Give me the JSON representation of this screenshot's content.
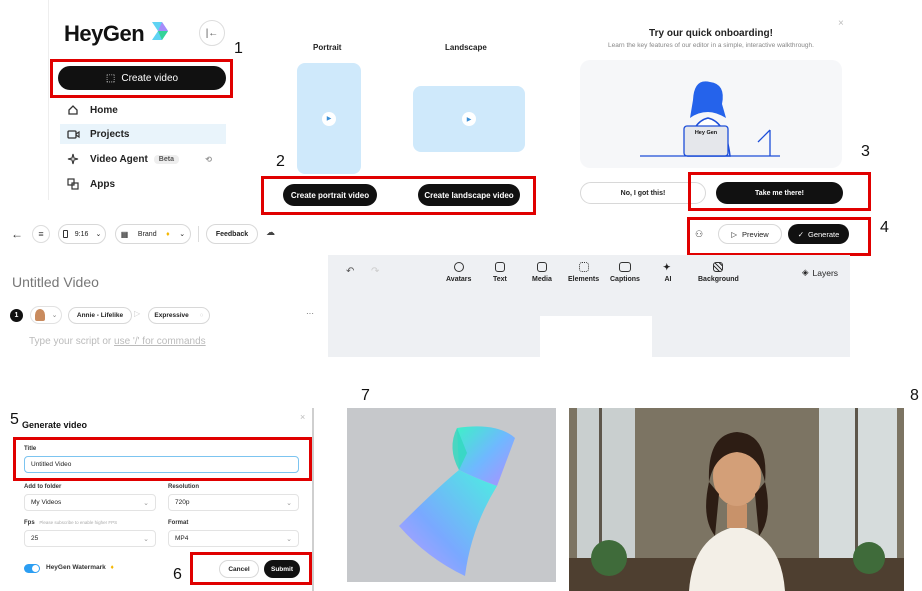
{
  "steps": {
    "s1": "1",
    "s2": "2",
    "s3": "3",
    "s4": "4",
    "s5": "5",
    "s6": "6",
    "s7": "7",
    "s8": "8"
  },
  "brand": {
    "logo_text": "HeyGen"
  },
  "sidebar": {
    "create_video_label": "Create video",
    "items": [
      {
        "label": "Home",
        "icon": "home-icon"
      },
      {
        "label": "Projects",
        "icon": "video-camera-icon"
      },
      {
        "label": "Video Agent",
        "icon": "sparkle-icon",
        "badge": "Beta"
      },
      {
        "label": "Apps",
        "icon": "apps-icon"
      }
    ]
  },
  "orientation": {
    "portrait_label": "Portrait",
    "landscape_label": "Landscape",
    "create_portrait_label": "Create portrait video",
    "create_landscape_label": "Create landscape video"
  },
  "onboarding": {
    "title": "Try our quick onboarding!",
    "subtitle": "Learn the key features of our editor in a simple, interactive walkthrough.",
    "dismiss_label": "No, I got this!",
    "accept_label": "Take me there!",
    "illustration_badge": "Hey Gen"
  },
  "editor_toolbar": {
    "ratio": "9:16",
    "brand_label": "Brand",
    "feedback_label": "Feedback",
    "preview_label": "Preview",
    "generate_label": "Generate"
  },
  "editor": {
    "video_title": "Untitled Video",
    "scene_number": "1",
    "avatar_name": "Annie - Lifelike",
    "style_label": "Expressive",
    "script_placeholder": "Type your script or ",
    "script_link": "use '/' for commands",
    "more": "···",
    "tools": [
      "Avatars",
      "Text",
      "Media",
      "Elements",
      "Captions",
      "AI",
      "Background"
    ],
    "layers_label": "Layers"
  },
  "generate_dialog": {
    "heading": "Generate video",
    "title_label": "Title",
    "title_value": "Untitled Video",
    "folder_label": "Add to folder",
    "folder_value": "My Videos",
    "resolution_label": "Resolution",
    "resolution_value": "720p",
    "fps_label": "Fps",
    "fps_hint": "Please subscribe to enable higher FPS",
    "fps_value": "25",
    "format_label": "Format",
    "format_value": "MP4",
    "watermark_label": "HeyGen Watermark",
    "cancel_label": "Cancel",
    "submit_label": "Submit",
    "close": "×"
  },
  "colors": {
    "accent_red": "#e00000",
    "dark_button": "#111111",
    "preview_blue": "#cfe9fb",
    "play_blue": "#3a8fd6"
  }
}
